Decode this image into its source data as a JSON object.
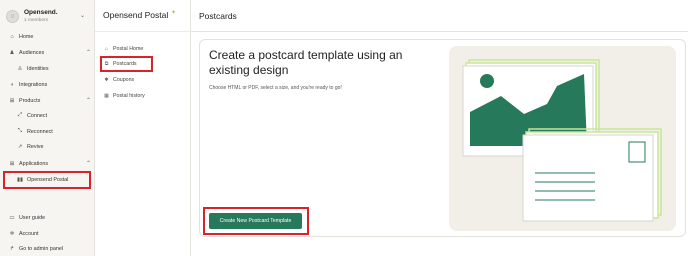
{
  "workspace": {
    "name": "Opensend.",
    "members": "1 members"
  },
  "nav": {
    "home": "Home",
    "audiences": "Audiences",
    "identities": "Identities",
    "integrations": "Integrations",
    "products": "Products",
    "connect": "Connect",
    "reconnect": "Reconnect",
    "revive": "Revive",
    "applications": "Applications",
    "opensend_postal": "Opensend Postal",
    "user_guide": "User guide",
    "account": "Account",
    "admin_panel": "Go to admin panel"
  },
  "postal_nav": {
    "title": "Opensend Postal",
    "items": [
      "Postal Home",
      "Postcards",
      "Coupons",
      "Postal history"
    ]
  },
  "header": {
    "title": "Postcards"
  },
  "card": {
    "title": "Create a postcard template using an existing design",
    "description": "Choose HTML or PDF, select a size, and you're ready to go!",
    "cta_label": "Create New Postcard Template"
  },
  "colors": {
    "brand_green": "#26795a",
    "highlight_red": "#d8232a",
    "accent_lime": "#c7e59a"
  }
}
